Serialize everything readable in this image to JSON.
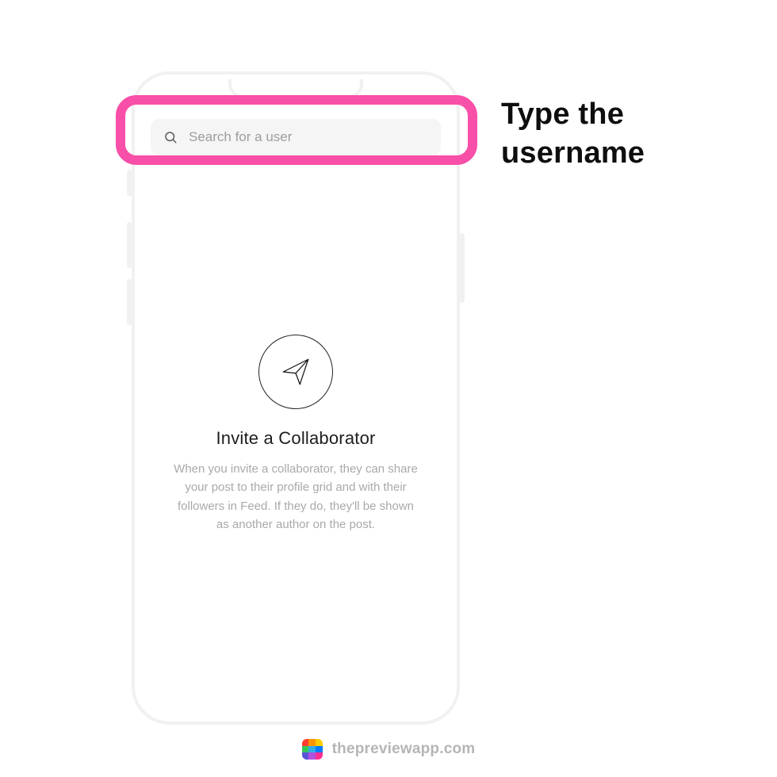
{
  "instruction": "Type the\nusername",
  "search": {
    "placeholder": "Search for a user"
  },
  "empty_state": {
    "title": "Invite a Collaborator",
    "body": "When you invite a collaborator, they can share your post to their profile grid and with their followers in Feed. If they do, they'll be shown as another author on the post."
  },
  "footer": {
    "url": "thepreviewapp.com"
  },
  "logo_colors": [
    "#ff3b30",
    "#ff9500",
    "#ffcc00",
    "#34c759",
    "#32ade6",
    "#007aff",
    "#5856d6",
    "#af52de",
    "#ff2d92"
  ],
  "highlight_color": "#f84fa8"
}
